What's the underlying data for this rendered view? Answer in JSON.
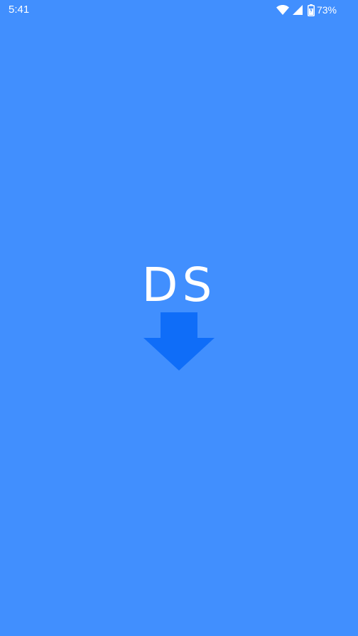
{
  "status_bar": {
    "time": "5:41",
    "battery_percent": "73%",
    "icons": [
      "wifi-icon",
      "cell-signal-icon",
      "battery-icon"
    ]
  },
  "splash": {
    "logo_text": "DS",
    "logo_icon": "download-arrow-icon"
  },
  "colors": {
    "background": "#418FFE",
    "arrow": "#0F6DF8",
    "text": "#FFFFFF"
  }
}
